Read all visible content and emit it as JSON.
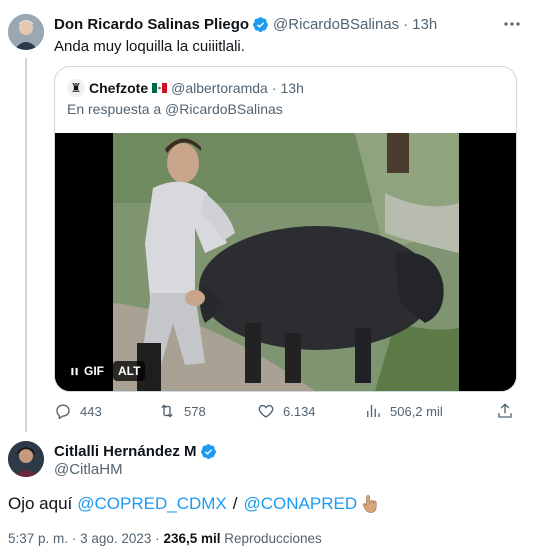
{
  "tweet": {
    "name": "Don Ricardo Salinas Pliego",
    "handle": "@RicardoBSalinas",
    "separator": "·",
    "time": "13h",
    "text": "Anda muy loquilla la cuiiitlali."
  },
  "quote": {
    "avatar_glyph": "♜",
    "name": "Chefzote",
    "handle": "@albertoramda",
    "separator": "·",
    "time": "13h",
    "reply_line": "En respuesta a @RicardoBSalinas",
    "media": {
      "gif_label": "GIF",
      "alt_label": "ALT"
    }
  },
  "actions": {
    "replies": "443",
    "retweets": "578",
    "likes": "6.134",
    "views": "506,2 mil"
  },
  "reply": {
    "name": "Citlalli Hernández M",
    "handle": "@CitlaHM",
    "text_prefix": "Ojo aquí",
    "mention1": "@COPRED_CDMX",
    "slash": "/",
    "mention2": "@CONAPRED",
    "meta": {
      "time": "5:37 p. m.",
      "date_sep": "·",
      "date": "3 ago. 2023",
      "views_sep": "·",
      "views_count": "236,5 mil",
      "views_label": "Reproducciones"
    }
  },
  "colors": {
    "link": "#1d9bf0",
    "verified": "#1d9bf0",
    "secondary_text": "#536471",
    "border": "#cfd9de"
  }
}
